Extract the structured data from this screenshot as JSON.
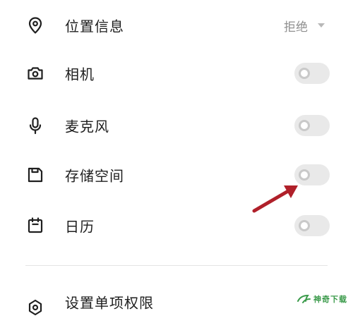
{
  "permissions": {
    "location": {
      "label": "位置信息",
      "value": "拒绝",
      "icon": "location-pin-icon"
    },
    "camera": {
      "label": "相机",
      "enabled": false,
      "icon": "camera-icon"
    },
    "microphone": {
      "label": "麦克风",
      "enabled": false,
      "icon": "microphone-icon"
    },
    "storage": {
      "label": "存储空间",
      "enabled": false,
      "icon": "storage-icon"
    },
    "calendar": {
      "label": "日历",
      "enabled": false,
      "icon": "calendar-icon"
    },
    "individual": {
      "label": "设置单项权限",
      "icon": "settings-icon"
    }
  },
  "annotation": {
    "arrow_color": "#b0202a"
  },
  "watermark": {
    "text": "神奇下载",
    "color": "#3a9a4a"
  },
  "colors": {
    "toggle_off_track": "#e9e9e9",
    "toggle_knob_border": "#c9c9c9",
    "muted_text": "#8f8f8f"
  }
}
